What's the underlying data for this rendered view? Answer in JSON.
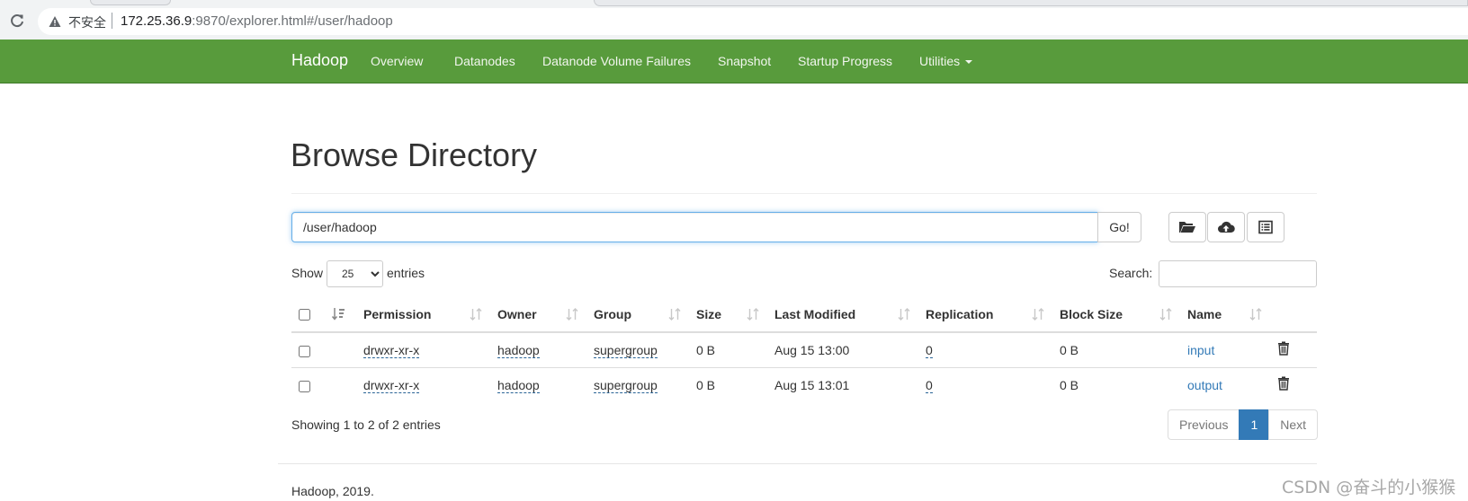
{
  "browser": {
    "security_label": "不安全",
    "url_host": "172.25.36.9",
    "url_rest": ":9870/explorer.html#/user/hadoop"
  },
  "navbar": {
    "brand": "Hadoop",
    "items": [
      {
        "label": "Overview"
      },
      {
        "label": "Datanodes"
      },
      {
        "label": "Datanode Volume Failures"
      },
      {
        "label": "Snapshot"
      },
      {
        "label": "Startup Progress"
      },
      {
        "label": "Utilities"
      }
    ]
  },
  "page": {
    "title": "Browse Directory",
    "path_value": "/user/hadoop",
    "go_label": "Go!"
  },
  "table_controls": {
    "show_label": "Show",
    "entries_selected": "25",
    "entries_label": "entries",
    "search_label": "Search:"
  },
  "table": {
    "columns": [
      "Permission",
      "Owner",
      "Group",
      "Size",
      "Last Modified",
      "Replication",
      "Block Size",
      "Name"
    ],
    "rows": [
      {
        "permission": "drwxr-xr-x",
        "owner": "hadoop",
        "group": "supergroup",
        "size": "0 B",
        "last_modified": "Aug 15 13:00",
        "replication": "0",
        "block_size": "0 B",
        "name": "input"
      },
      {
        "permission": "drwxr-xr-x",
        "owner": "hadoop",
        "group": "supergroup",
        "size": "0 B",
        "last_modified": "Aug 15 13:01",
        "replication": "0",
        "block_size": "0 B",
        "name": "output"
      }
    ]
  },
  "info": "Showing 1 to 2 of 2 entries",
  "pagination": {
    "previous": "Previous",
    "current": "1",
    "next": "Next"
  },
  "footer": "Hadoop, 2019.",
  "watermark": "CSDN @奋斗的小猴猴",
  "colors": {
    "navbar": "#589b3c",
    "link": "#337ab7",
    "active_page": "#337ab7"
  },
  "icons": [
    "reload-icon",
    "warning-icon",
    "folder-open-icon",
    "cloud-upload-icon",
    "list-alt-icon",
    "sort-icon",
    "trash-icon",
    "caret-down-icon"
  ]
}
